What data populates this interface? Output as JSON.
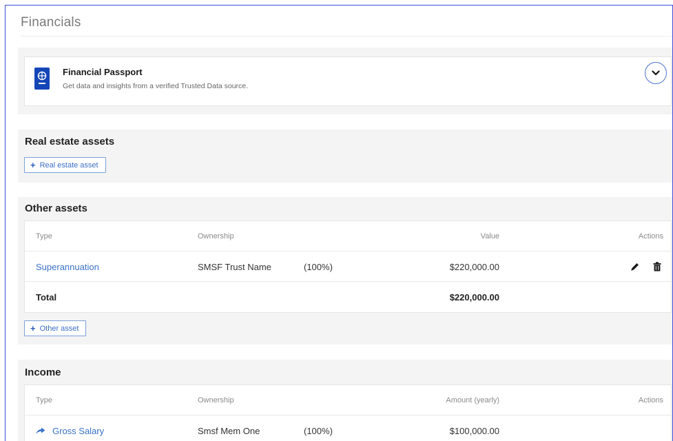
{
  "page": {
    "title": "Financials"
  },
  "passport": {
    "title": "Financial Passport",
    "subtitle": "Get data and insights from a verified Trusted Data source.",
    "icon": "passport-icon",
    "accent": "#1546b8"
  },
  "real_estate": {
    "title": "Real estate assets",
    "add_label": "Real estate asset"
  },
  "other_assets": {
    "title": "Other assets",
    "headers": {
      "type": "Type",
      "ownership": "Ownership",
      "value": "Value",
      "actions": "Actions"
    },
    "rows": [
      {
        "type": "Superannuation",
        "owner": "SMSF Trust Name",
        "share": "(100%)",
        "value": "$220,000.00"
      }
    ],
    "total_label": "Total",
    "total_value": "$220,000.00",
    "add_label": "Other asset"
  },
  "income": {
    "title": "Income",
    "headers": {
      "type": "Type",
      "ownership": "Ownership",
      "amount": "Amount (yearly)",
      "actions": "Actions"
    },
    "rows": [
      {
        "type": "Gross Salary",
        "owner": "Smsf Mem One",
        "share": "(100%)",
        "amount": "$100,000.00"
      }
    ]
  },
  "colors": {
    "link": "#3a73c8",
    "border_accent": "#3d4fd6",
    "section_bg": "#f4f4f4"
  }
}
